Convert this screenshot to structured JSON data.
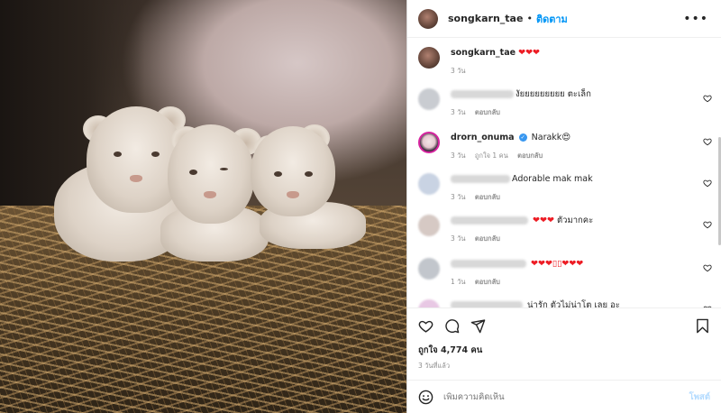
{
  "post": {
    "username": "songkarn_tae",
    "follow_label": "ติดตาม",
    "more_icon": "more-horizontal-icon",
    "caption": {
      "username": "songkarn_tae",
      "text": "❤❤❤",
      "time": "3 วัน"
    },
    "likes_label": "ถูกใจ 4,774 คน",
    "time_ago": "3 วันที่แล้ว",
    "add_comment_placeholder": "เพิ่มความคิดเห็น",
    "post_label": "โพสต์"
  },
  "comments": [
    {
      "username_hidden": true,
      "text": "งัยยยยยยยยย ตะเล็ก",
      "time": "3 วัน",
      "reply": "ตอบกลับ",
      "likes": ""
    },
    {
      "username": "drorn_onuma",
      "verified": true,
      "text": "Narakk😍",
      "time": "3 วัน",
      "likes": "ถูกใจ 1 คน",
      "reply": "ตอบกลับ"
    },
    {
      "username_hidden": true,
      "text": "Adorable mak mak",
      "time": "3 วัน",
      "reply": "ตอบกลับ",
      "likes": ""
    },
    {
      "username_hidden": true,
      "text_prefix": "❤❤❤",
      "text": "ตัวมากคะ",
      "time": "3 วัน",
      "reply": "ตอบกลับ",
      "likes": ""
    },
    {
      "username_hidden": true,
      "text": "❤❤❤▯▯❤❤❤",
      "time": "1 วัน",
      "reply": "ตอบกลับ",
      "likes": ""
    },
    {
      "username_hidden": true,
      "text": "น่ารัก ตัวไม่น่าโต เลย อะ",
      "time": "",
      "reply": "",
      "likes": ""
    }
  ],
  "colors": {
    "accent": "#0095f6",
    "heart": "#ed1c24",
    "muted": "#8e8e8e"
  }
}
